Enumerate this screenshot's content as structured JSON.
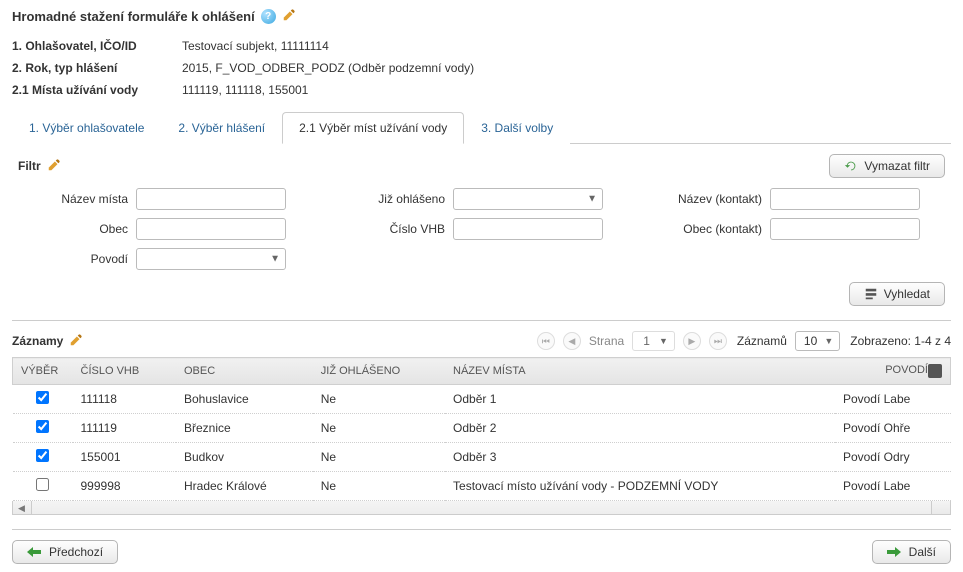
{
  "title": "Hromadné stažení formuláře k ohlášení",
  "summary": {
    "l1": "1. Ohlašovatel, IČO/ID",
    "v1": "Testovací subjekt, 11111114",
    "l2": "2. Rok, typ hlášení",
    "v2": "2015, F_VOD_ODBER_PODZ (Odběr podzemní vody)",
    "l3": "2.1 Místa užívání vody",
    "v3": "111119, 111118, 155001"
  },
  "tabs": {
    "t1": "1. Výběr ohlašovatele",
    "t2": "2. Výběr hlášení",
    "t3": "2.1 Výběr míst užívání vody",
    "t4": "3. Další volby"
  },
  "filter": {
    "title": "Filtr",
    "clear": "Vymazat filtr",
    "nazev_mista": {
      "label": "Název místa",
      "value": ""
    },
    "obec": {
      "label": "Obec",
      "value": ""
    },
    "povodi": {
      "label": "Povodí",
      "value": ""
    },
    "jiz_ohlaseno": {
      "label": "Již ohlášeno",
      "value": ""
    },
    "cislo_vhb": {
      "label": "Číslo VHB",
      "value": ""
    },
    "nazev_kontakt": {
      "label": "Název (kontakt)",
      "value": ""
    },
    "obec_kontakt": {
      "label": "Obec (kontakt)",
      "value": ""
    },
    "search": "Vyhledat"
  },
  "records": {
    "title": "Záznamy",
    "page_label": "Strana",
    "page_current": "1",
    "per_page_label": "Záznamů",
    "per_page_value": "10",
    "shown_label": "Zobrazeno: 1-4 z 4",
    "columns": {
      "vyber": "VÝBĚR",
      "cislo_vhb": "ČÍSLO VHB",
      "obec": "OBEC",
      "jiz_ohlaseno": "JIŽ OHLÁŠENO",
      "nazev_mista": "NÁZEV MÍSTA",
      "povodi": "POVODÍ"
    },
    "rows": [
      {
        "checked": true,
        "cislo_vhb": "111118",
        "obec": "Bohuslavice",
        "jiz_ohlaseno": "Ne",
        "nazev_mista": "Odběr 1",
        "povodi": "Povodí Labe"
      },
      {
        "checked": true,
        "cislo_vhb": "111119",
        "obec": "Březnice",
        "jiz_ohlaseno": "Ne",
        "nazev_mista": "Odběr 2",
        "povodi": "Povodí Ohře"
      },
      {
        "checked": true,
        "cislo_vhb": "155001",
        "obec": "Budkov",
        "jiz_ohlaseno": "Ne",
        "nazev_mista": "Odběr 3",
        "povodi": "Povodí Odry"
      },
      {
        "checked": false,
        "cislo_vhb": "999998",
        "obec": "Hradec Králové",
        "jiz_ohlaseno": "Ne",
        "nazev_mista": "Testovací místo užívání vody - PODZEMNÍ VODY",
        "povodi": "Povodí Labe"
      }
    ]
  },
  "footer": {
    "prev": "Předchozí",
    "next": "Další"
  }
}
